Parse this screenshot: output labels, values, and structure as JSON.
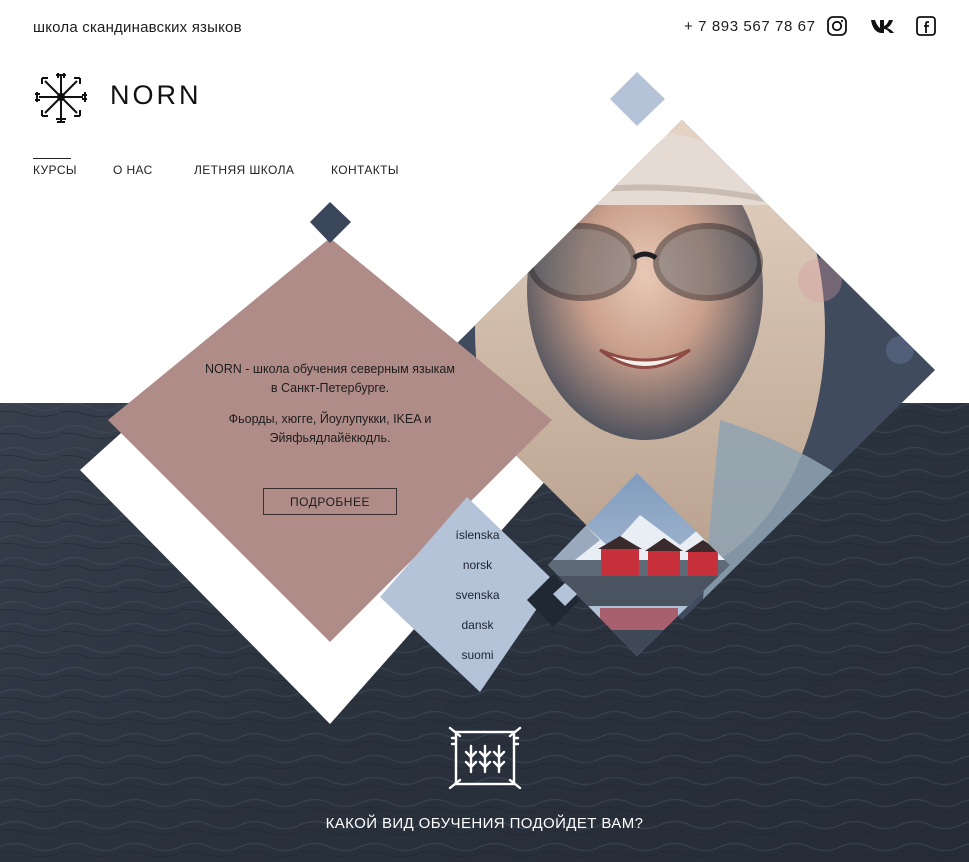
{
  "header": {
    "tagline": "школа скандинавских языков",
    "phone": "+ 7 893 567 78 67",
    "social": [
      {
        "name": "instagram-icon"
      },
      {
        "name": "vk-icon"
      },
      {
        "name": "facebook-icon"
      }
    ]
  },
  "brand": {
    "logo_icon": "vegvisir-icon",
    "name": "NORN"
  },
  "nav": {
    "items": [
      {
        "label": "КУРСЫ",
        "active": true
      },
      {
        "label": "О НАС",
        "active": false
      },
      {
        "label": "ЛЕТНЯЯ ШКОЛА",
        "active": false
      },
      {
        "label": "КОНТАКТЫ",
        "active": false
      }
    ]
  },
  "intro": {
    "line1": "NORN - школа обучения северным языкам в Санкт-Петербурге.",
    "line2": "Фьорды, хюгге, Йоулупукки,  IKEA и Эйяфьядлайёкюдль.",
    "button": "ПОДРОБНЕЕ"
  },
  "languages": [
    "íslenska",
    "norsk",
    "svenska",
    "dansk",
    "suomi"
  ],
  "footer_cta": "КАКОЙ ВИД ОБУЧЕНИЯ ПОДОЙДЕТ ВАМ?",
  "colors": {
    "rose": "#b08c88",
    "light_blue": "#b4c3d8",
    "slate": "#2e3a4d",
    "water": "#2f3846",
    "white": "#ffffff"
  }
}
